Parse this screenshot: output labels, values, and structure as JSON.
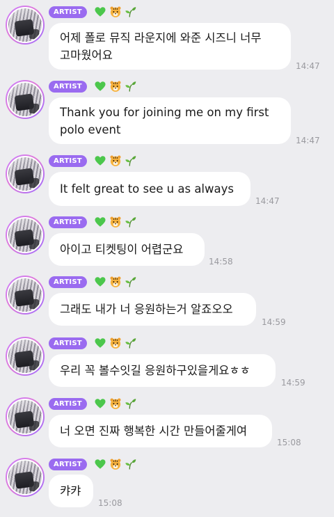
{
  "chat": {
    "badge_label": "ARTIST",
    "icons": {
      "heart": "green-heart-icon",
      "tiger": "tiger-face-icon",
      "sprout": "seedling-icon"
    },
    "colors": {
      "badge": "#9a6bf0",
      "background": "#ededf0",
      "bubble": "#ffffff",
      "timestamp": "#9a9a9f"
    },
    "messages": [
      {
        "text": "어제 폴로 뮤직 라운지에 와준 시즈니 너무\n고마웠어요",
        "time": "14:47"
      },
      {
        "text": "Thank you for joining me on my first\npolo event",
        "time": "14:47"
      },
      {
        "text": "It felt great to see u as always",
        "time": "14:47"
      },
      {
        "text": "아이고 티켓팅이 어렵군요",
        "time": "14:58"
      },
      {
        "text": "그래도 내가 너 응원하는거 알죠오오",
        "time": "14:59"
      },
      {
        "text": "우리 꼭 볼수잇길 응원하구있을게요ㅎㅎ",
        "time": "14:59"
      },
      {
        "text": "너 오면 진짜 행복한 시간 만들어줄게여",
        "time": "15:08"
      },
      {
        "text": "캬캬",
        "time": "15:08"
      }
    ]
  }
}
